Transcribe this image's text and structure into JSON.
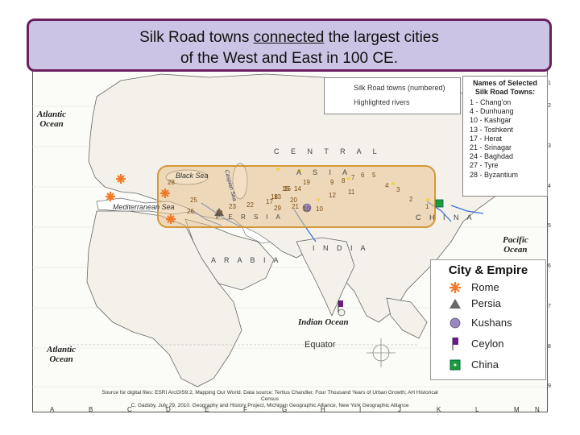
{
  "title": {
    "line1_before": "Silk Road towns ",
    "line1_emph": "connected",
    "line1_after": " the largest cities",
    "line2": "of the West and East in 100 CE."
  },
  "legend_top": {
    "silk_road_towns": "Silk Road towns (numbered)",
    "rivers": "Highlighted rivers"
  },
  "names_box": {
    "title_line1": "Names of Selected",
    "title_line2": "Silk Road Towns:",
    "items": [
      "1 - Chang'on",
      "4 - Dunhuang",
      "10 - Kashgar",
      "13 - Toshkent",
      "17 - Herat",
      "21 - Srinagar",
      "24 - Baghdad",
      "27 - Tyre",
      "28 - Byzantium"
    ]
  },
  "city_empire": {
    "title": "City & Empire",
    "items": [
      {
        "label": "Rome",
        "icon": "rome-asterisk-icon",
        "color": "#f07a2a"
      },
      {
        "label": "Persia",
        "icon": "persia-triangle-icon",
        "color": "#666666"
      },
      {
        "label": "Kushans",
        "icon": "kushans-circle-icon",
        "color": "#9a86c2"
      },
      {
        "label": "Ceylon",
        "icon": "ceylon-flag-icon",
        "color": "#6a1a8a"
      },
      {
        "label": "China",
        "icon": "china-square-icon",
        "color": "#1c9c3c"
      }
    ]
  },
  "map_labels": {
    "atlantic_top": "Atlantic\nOcean",
    "atlantic_bottom": "Atlantic\nOcean",
    "pacific": "Pacific\nOcean",
    "indian": "Indian Ocean",
    "mediterranean": "Mediterranean Sea",
    "black_sea": "Black Sea",
    "caspian": "Caspian Sea",
    "central": "C E N T R A L",
    "asia": "A S I A",
    "persia": "P E R S I A",
    "india": "I N D I A",
    "arabia": "A R A B I A",
    "china": "C H I N A",
    "equator": "Equator"
  },
  "town_numbers": [
    {
      "n": "28"
    },
    {
      "n": "25"
    },
    {
      "n": "26"
    },
    {
      "n": "24"
    },
    {
      "n": "23"
    },
    {
      "n": "22"
    },
    {
      "n": "17"
    },
    {
      "n": "18"
    },
    {
      "n": "15"
    },
    {
      "n": "14"
    },
    {
      "n": "13"
    },
    {
      "n": "19"
    },
    {
      "n": "20"
    },
    {
      "n": "29"
    },
    {
      "n": "21"
    },
    {
      "n": "10"
    },
    {
      "n": "10"
    },
    {
      "n": "12"
    },
    {
      "n": "11"
    },
    {
      "n": "9"
    },
    {
      "n": "8"
    },
    {
      "n": "7"
    },
    {
      "n": "6"
    },
    {
      "n": "5"
    },
    {
      "n": "4"
    },
    {
      "n": "3"
    },
    {
      "n": "2"
    },
    {
      "n": "1"
    },
    {
      "n": "16"
    }
  ],
  "source_text": "Source for digital files: ESRI ArcGIS9.2, Mapping Our World. Data source: Tertius Chandler, Four Thousand Years of Urban Growth; AH Historical Census\nC. Gadsby, July 29, 2010. Geography and History Project, Michigan Geographic Alliance, New York Geographic Alliance",
  "grid_columns": [
    "A",
    "B",
    "C",
    "D",
    "E",
    "F",
    "G",
    "H",
    "I",
    "J",
    "K",
    "L",
    "M",
    "N"
  ],
  "grid_rows": [
    "1",
    "2",
    "3",
    "4",
    "5",
    "6",
    "7",
    "8",
    "9"
  ]
}
